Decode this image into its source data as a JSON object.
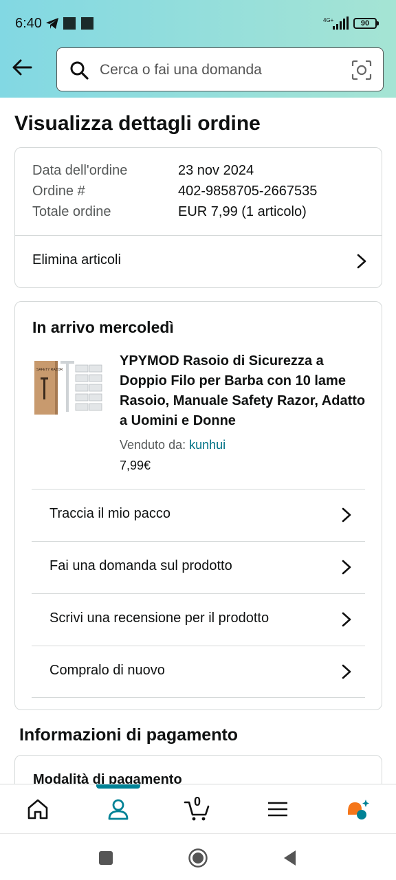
{
  "status_bar": {
    "time": "6:40",
    "network": "4G+",
    "battery": "90"
  },
  "search": {
    "placeholder": "Cerca o fai una domanda"
  },
  "page": {
    "title": "Visualizza dettagli ordine"
  },
  "order_summary": {
    "rows": [
      {
        "label": "Data dell'ordine",
        "value": "23 nov 2024"
      },
      {
        "label": "Ordine #",
        "value": "402-9858705-2667535"
      },
      {
        "label": "Totale ordine",
        "value": "EUR 7,99 (1 articolo)"
      }
    ],
    "delete_items_label": "Elimina articoli"
  },
  "delivery": {
    "title": "In arrivo mercoledì",
    "product": {
      "title": "YPYMOD Rasoio di Sicurezza a Doppio Filo per Barba con 10 lame Rasoio, Manuale Safety Razor, Adatto a Uomini e Donne",
      "sold_by_label": "Venduto da:",
      "seller": "kunhui",
      "price": "7,99€",
      "image_box_text": "SAFETY RAZOR"
    },
    "actions": [
      {
        "label": "Traccia il mio pacco"
      },
      {
        "label": "Fai una domanda sul prodotto"
      },
      {
        "label": "Scrivi una recensione per il prodotto"
      },
      {
        "label": "Compralo di nuovo"
      }
    ]
  },
  "payment": {
    "title": "Informazioni di pagamento",
    "method_label": "Modalità di pagamento"
  },
  "bottom_nav": {
    "cart_count": "0",
    "active": "account",
    "items": [
      "home-icon",
      "account-icon",
      "cart-icon",
      "menu-icon",
      "rufus-icon"
    ]
  },
  "colors": {
    "header_start": "#82d8e3",
    "header_end": "#a5e4d4",
    "link": "#007185",
    "active_nav": "#008296"
  }
}
